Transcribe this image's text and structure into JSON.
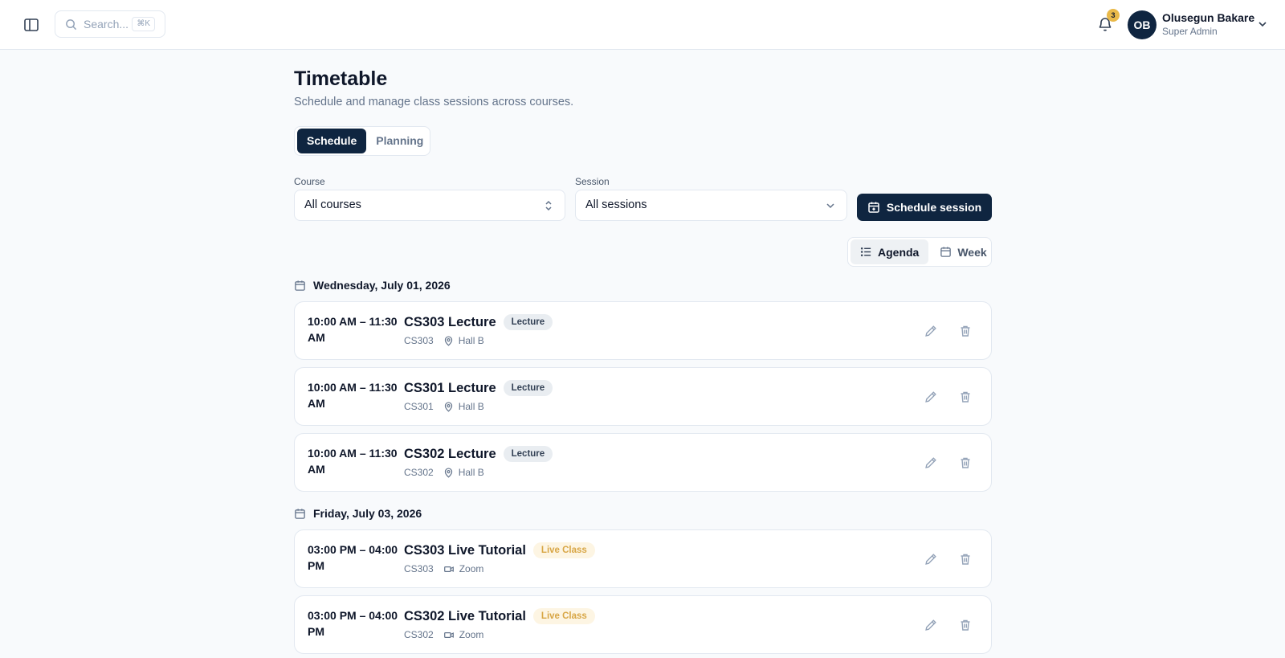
{
  "header": {
    "search_placeholder": "Search...",
    "search_shortcut": "⌘K",
    "notification_count": "3",
    "user": {
      "initials": "OB",
      "name": "Olusegun Bakare",
      "role": "Super Admin"
    }
  },
  "page": {
    "title": "Timetable",
    "subtitle": "Schedule and manage class sessions across courses."
  },
  "tabs": [
    {
      "label": "Schedule",
      "active": true
    },
    {
      "label": "Planning",
      "active": false
    }
  ],
  "filters": {
    "course_label": "Course",
    "course_value": "All courses",
    "session_label": "Session",
    "session_value": "All sessions"
  },
  "actions": {
    "schedule_session": "Schedule session"
  },
  "views": [
    {
      "label": "Agenda",
      "active": true
    },
    {
      "label": "Week",
      "active": false
    }
  ],
  "days": [
    {
      "date": "Wednesday, July 01, 2026",
      "sessions": [
        {
          "time": "10:00 AM – 11:30 AM",
          "title": "CS303 Lecture",
          "badge": "Lecture",
          "badge_type": "lecture",
          "course": "CS303",
          "location": "Hall B",
          "location_icon": "map-pin-icon"
        },
        {
          "time": "10:00 AM – 11:30 AM",
          "title": "CS301 Lecture",
          "badge": "Lecture",
          "badge_type": "lecture",
          "course": "CS301",
          "location": "Hall B",
          "location_icon": "map-pin-icon"
        },
        {
          "time": "10:00 AM – 11:30 AM",
          "title": "CS302 Lecture",
          "badge": "Lecture",
          "badge_type": "lecture",
          "course": "CS302",
          "location": "Hall B",
          "location_icon": "map-pin-icon"
        }
      ]
    },
    {
      "date": "Friday, July 03, 2026",
      "sessions": [
        {
          "time": "03:00 PM – 04:00 PM",
          "title": "CS303 Live Tutorial",
          "badge": "Live Class",
          "badge_type": "live",
          "course": "CS303",
          "location": "Zoom",
          "location_icon": "video-icon"
        },
        {
          "time": "03:00 PM – 04:00 PM",
          "title": "CS302 Live Tutorial",
          "badge": "Live Class",
          "badge_type": "live",
          "course": "CS302",
          "location": "Zoom",
          "location_icon": "video-icon"
        }
      ]
    }
  ],
  "colors": {
    "primary": "#0f2540",
    "live_badge_text": "#d8a645",
    "live_badge_bg": "#fdf5e3",
    "notification_badge": "#e9b949"
  }
}
